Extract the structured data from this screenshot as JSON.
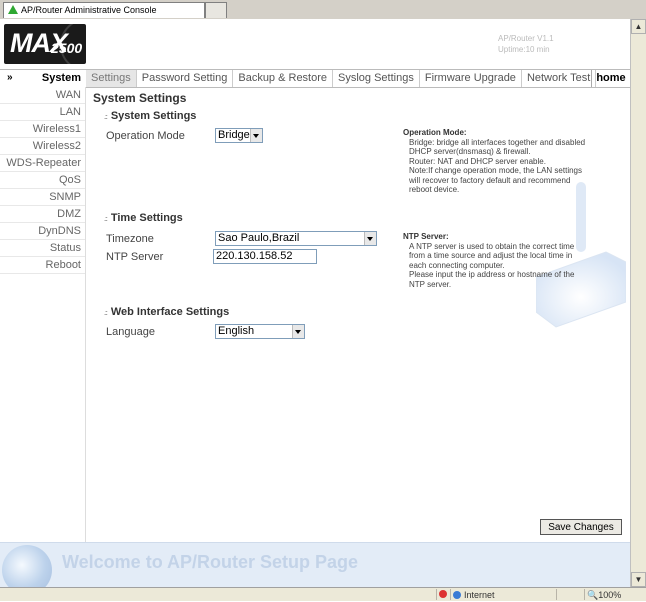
{
  "browser": {
    "tab_title": "AP/Router Administrative Console",
    "status": {
      "zone": "Internet",
      "zoom": "100%"
    }
  },
  "header": {
    "logo_text": "MAX",
    "logo_number": "2500",
    "model": "AP/Router V1.1",
    "uptime_label": "Uptime:",
    "uptime_value": "10 min"
  },
  "nav": {
    "current_section": "System",
    "tabs": [
      {
        "label": "Settings"
      },
      {
        "label": "Password Setting"
      },
      {
        "label": "Backup & Restore"
      },
      {
        "label": "Syslog Settings"
      },
      {
        "label": "Firmware Upgrade"
      },
      {
        "label": "Network Test"
      }
    ],
    "home_label": "home"
  },
  "sidebar": {
    "items": [
      {
        "label": "WAN"
      },
      {
        "label": "LAN"
      },
      {
        "label": "Wireless1"
      },
      {
        "label": "Wireless2"
      },
      {
        "label": "WDS-Repeater"
      },
      {
        "label": "QoS"
      },
      {
        "label": "SNMP"
      },
      {
        "label": "DMZ"
      },
      {
        "label": "DynDNS"
      },
      {
        "label": "Status"
      },
      {
        "label": "Reboot"
      }
    ]
  },
  "main": {
    "page_title": "System Settings",
    "system": {
      "title": "System Settings",
      "operation_mode_label": "Operation Mode",
      "operation_mode_value": "Bridge",
      "help_title": "Operation Mode:",
      "help_lines": [
        "Bridge: bridge all interfaces together and disabled",
        "DHCP server(dnsmasq) & firewall.",
        "Router: NAT and DHCP server enable.",
        "Note:If change operation mode, the LAN settings",
        "will recover to factory default and recommend",
        "reboot device."
      ]
    },
    "time": {
      "title": "Time Settings",
      "timezone_label": "Timezone",
      "timezone_value": "Sao Paulo,Brazil",
      "ntp_label": "NTP Server",
      "ntp_value": "220.130.158.52",
      "help_title": "NTP Server:",
      "help_lines": [
        "A NTP server is used to obtain the correct time",
        "from a time source and adjust the local time in",
        "each connecting computer.",
        "Please input the ip address or hostname of the",
        "NTP server."
      ]
    },
    "web": {
      "title": "Web Interface Settings",
      "language_label": "Language",
      "language_value": "English"
    },
    "save_label": "Save Changes"
  },
  "footer": {
    "welcome_text": "Welcome to AP/Router Setup Page"
  }
}
